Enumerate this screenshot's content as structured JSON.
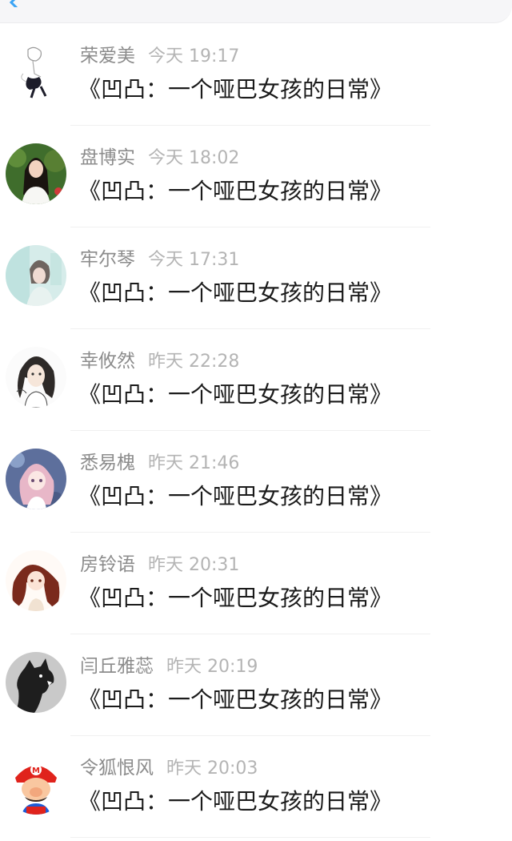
{
  "header": {
    "back_icon": "chevron-left-icon"
  },
  "comments": [
    {
      "name": "荣爱美",
      "time": "今天 19:17",
      "text": "《凹凸：一个哑巴女孩的日常》",
      "avatar_icon": "sketch-figure-avatar"
    },
    {
      "name": "盘博实",
      "time": "今天 18:02",
      "text": "《凹凸：一个哑巴女孩的日常》",
      "avatar_icon": "girl-photo-avatar"
    },
    {
      "name": "牢尔琴",
      "time": "今天 17:31",
      "text": "《凹凸：一个哑巴女孩的日常》",
      "avatar_icon": "light-photo-avatar"
    },
    {
      "name": "幸攸然",
      "time": "昨天 22:28",
      "text": "《凹凸：一个哑巴女孩的日常》",
      "avatar_icon": "drawn-girl-avatar"
    },
    {
      "name": "悉易槐",
      "time": "昨天 21:46",
      "text": "《凹凸：一个哑巴女孩的日常》",
      "avatar_icon": "anime-girl-avatar"
    },
    {
      "name": "房铃语",
      "time": "昨天 20:31",
      "text": "《凹凸：一个哑巴女孩的日常》",
      "avatar_icon": "red-hair-anime-avatar"
    },
    {
      "name": "闫丘雅蕊",
      "time": "昨天 20:19",
      "text": "《凹凸：一个哑巴女孩的日常》",
      "avatar_icon": "wolf-head-avatar"
    },
    {
      "name": "令狐恨风",
      "time": "昨天 20:03",
      "text": "《凹凸：一个哑巴女孩的日常》",
      "avatar_icon": "mario-avatar"
    }
  ]
}
